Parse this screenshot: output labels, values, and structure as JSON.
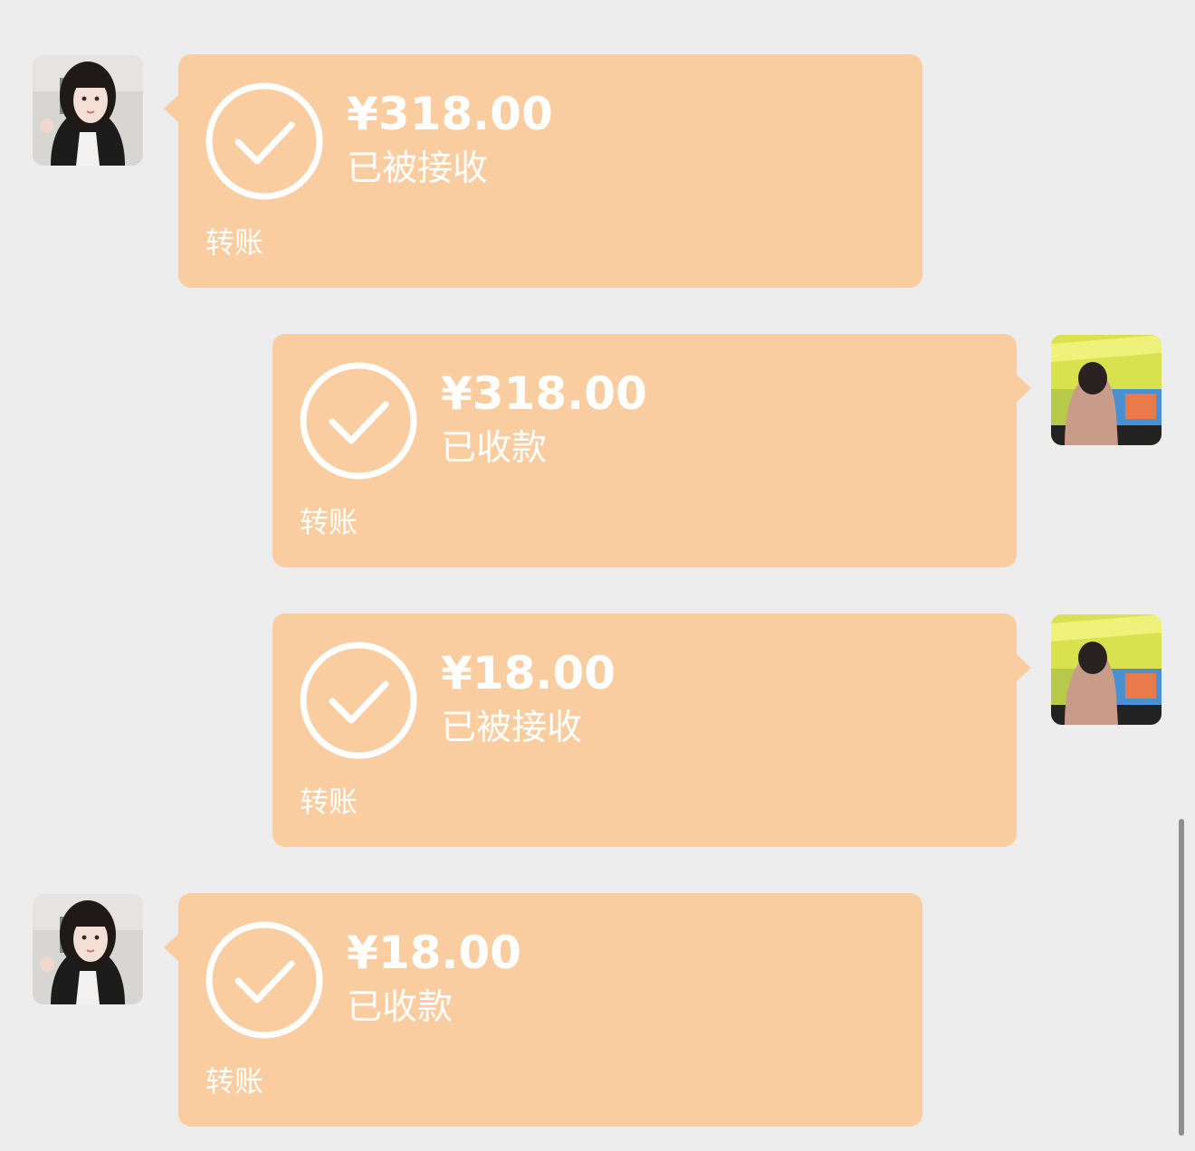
{
  "theme": {
    "background": "#ededed",
    "bubble_color": "#f9cd9f",
    "text_color": "#ffffff"
  },
  "messages": [
    {
      "side": "left",
      "avatar_icon": "contact-avatar-photo",
      "icon": "check-circle-icon",
      "amount": "¥318.00",
      "status": "已被接收",
      "type_label": "转账"
    },
    {
      "side": "right",
      "avatar_icon": "self-avatar-photo",
      "icon": "check-circle-icon",
      "amount": "¥318.00",
      "status": "已收款",
      "type_label": "转账"
    },
    {
      "side": "right",
      "avatar_icon": "self-avatar-photo",
      "icon": "check-circle-icon",
      "amount": "¥18.00",
      "status": "已被接收",
      "type_label": "转账"
    },
    {
      "side": "left",
      "avatar_icon": "contact-avatar-photo",
      "icon": "check-circle-icon",
      "amount": "¥18.00",
      "status": "已收款",
      "type_label": "转账"
    }
  ]
}
